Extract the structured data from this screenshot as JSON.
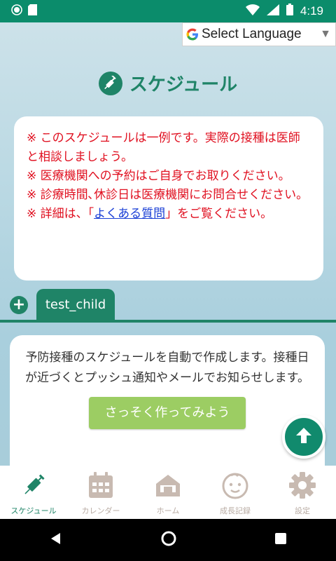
{
  "status_bar": {
    "time": "4:19"
  },
  "language_selector": {
    "label": "Select Language"
  },
  "page": {
    "title": "スケジュール"
  },
  "notice": {
    "line1": "※ このスケジュールは一例です。実際の接種は医師と相談しましょう。",
    "line2": "※ 医療機関への予約はご自身でお取りください。",
    "line3": "※ 診療時間､休診日は医療機関にお問合せください。",
    "line4_prefix": "※ 詳細は、「",
    "line4_link": "よくある質問",
    "line4_suffix": "」をご覧ください。"
  },
  "tabs": {
    "add": "+",
    "active_label": "test_child"
  },
  "card": {
    "description": "予防接種のスケジュールを自動で作成します。接種日が近づくとプッシュ通知やメールでお知らせします。",
    "cta_label": "さっそく作ってみよう"
  },
  "bottom_nav": {
    "items": [
      {
        "label": "スケジュール",
        "icon": "syringe-icon"
      },
      {
        "label": "カレンダー",
        "icon": "calendar-icon"
      },
      {
        "label": "ホーム",
        "icon": "home-icon"
      },
      {
        "label": "成長記録",
        "icon": "baby-face-icon"
      },
      {
        "label": "設定",
        "icon": "gear-icon"
      }
    ]
  },
  "colors": {
    "brand": "#1f8467",
    "status_bar": "#0b8c6b",
    "warning": "#e01020",
    "link": "#1a3fd6",
    "cta": "#9ccd63",
    "inactive": "#c8bab1"
  }
}
